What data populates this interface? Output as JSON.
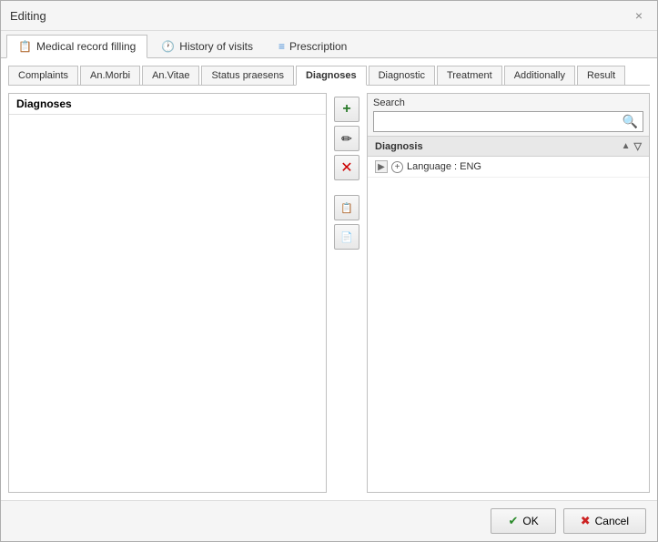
{
  "dialog": {
    "title": "Editing",
    "close_label": "×"
  },
  "main_tabs": [
    {
      "id": "medical",
      "label": "Medical record filling",
      "icon": "📋",
      "active": true
    },
    {
      "id": "history",
      "label": "History of visits",
      "icon": "🕐",
      "active": false
    },
    {
      "id": "prescription",
      "label": "Prescription",
      "icon": "📝",
      "active": false
    }
  ],
  "sub_tabs": [
    {
      "id": "complaints",
      "label": "Complaints",
      "active": false
    },
    {
      "id": "anmorbi",
      "label": "An.Morbi",
      "active": false
    },
    {
      "id": "anvitae",
      "label": "An.Vitae",
      "active": false
    },
    {
      "id": "status",
      "label": "Status praesens",
      "active": false
    },
    {
      "id": "diagnoses",
      "label": "Diagnoses",
      "active": true
    },
    {
      "id": "diagnostic",
      "label": "Diagnostic",
      "active": false
    },
    {
      "id": "treatment",
      "label": "Treatment",
      "active": false
    },
    {
      "id": "additionally",
      "label": "Additionally",
      "active": false
    },
    {
      "id": "result",
      "label": "Result",
      "active": false
    }
  ],
  "left_panel": {
    "header": "Diagnoses"
  },
  "toolbar": {
    "add_label": "+",
    "edit_label": "✏",
    "delete_label": "✕",
    "copy_label": "📋",
    "paste_label": "📄"
  },
  "search": {
    "label": "Search",
    "placeholder": "",
    "value": ""
  },
  "tree": {
    "header": "Diagnosis",
    "items": [
      {
        "id": "lang-eng",
        "label": "Language : ENG",
        "indent": 1,
        "has_arrow": true
      }
    ]
  },
  "footer": {
    "ok_label": "OK",
    "cancel_label": "Cancel"
  }
}
